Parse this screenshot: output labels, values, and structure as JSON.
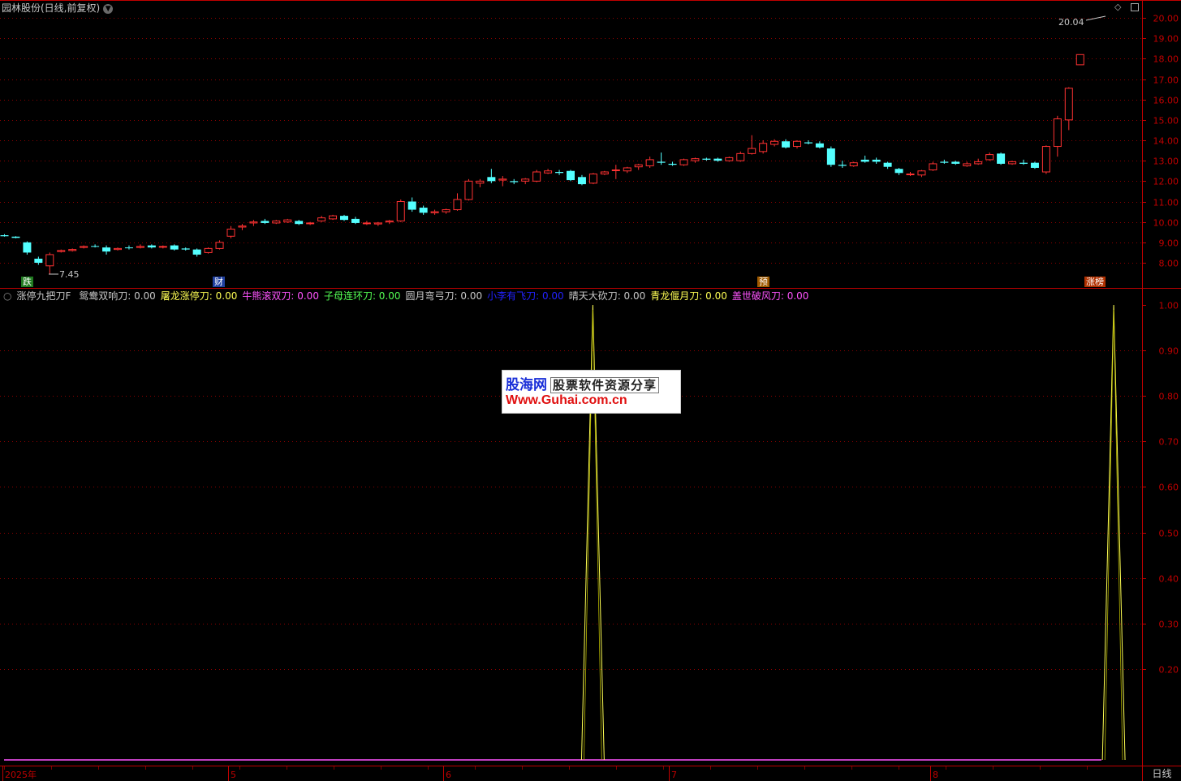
{
  "header": {
    "stock_title": "园林股份(日线,前复权)",
    "dropdown_icon": "chevron-down-icon",
    "max_price_label": "20.04",
    "min_price_label": "7.45"
  },
  "price_axis": {
    "ticks": [
      "20.00",
      "19.00",
      "18.00",
      "17.00",
      "16.00",
      "15.00",
      "14.00",
      "13.00",
      "12.00",
      "11.00",
      "10.00",
      "9.00",
      "8.00"
    ]
  },
  "indicator": {
    "name": "涨停九把刀F",
    "items": [
      {
        "label": "鸳鸯双响刀: 0.00",
        "color": "#c8c8c8"
      },
      {
        "label": "屠龙涨停刀: 0.00",
        "color": "#ffff54"
      },
      {
        "label": "牛熊滚双刀: 0.00",
        "color": "#ff54ff"
      },
      {
        "label": "子母连环刀: 0.00",
        "color": "#54ff54"
      },
      {
        "label": "圆月弯弓刀: 0.00",
        "color": "#c8c8c8"
      },
      {
        "label": "小李有飞刀: 0.00",
        "color": "#2222ff"
      },
      {
        "label": "晴天大砍刀: 0.00",
        "color": "#c8c8c8"
      },
      {
        "label": "青龙偃月刀: 0.00",
        "color": "#ffff54"
      },
      {
        "label": "盖世破风刀: 0.00",
        "color": "#ff54ff"
      }
    ],
    "axis_ticks": [
      "1.00",
      "0.90",
      "0.80",
      "0.70",
      "0.60",
      "0.50",
      "0.40",
      "0.30",
      "0.20"
    ]
  },
  "event_tags": [
    {
      "text": "跌",
      "bg": "#1f7a1f",
      "color": "#ffffff"
    },
    {
      "text": "财",
      "bg": "#1f3f9f",
      "color": "#ffffff"
    },
    {
      "text": "预",
      "bg": "#a05a00",
      "color": "#ffffff"
    },
    {
      "text": "涨榜",
      "bg": "#b03000",
      "color": "#ffffff"
    }
  ],
  "x_axis": {
    "labels": [
      "2025年",
      "5",
      "6",
      "7",
      "8"
    ]
  },
  "period_tab": "日线",
  "watermark": {
    "brand": "股海网",
    "slogan": "股票软件资源分享",
    "url": "Www.Guhai.com.cn"
  },
  "colors": {
    "up": "#ff3232",
    "down": "#54ffff",
    "grid": "#8b0000",
    "signal_line": "#ffff54",
    "baseline": "#ff54ff"
  },
  "chart_data": [
    {
      "type": "candlestick",
      "title": "园林股份(日线,前复权)",
      "ylim": [
        7.3,
        20.6
      ],
      "candles": [
        [
          9.35,
          9.4,
          9.28,
          9.3
        ],
        [
          9.28,
          9.3,
          9.2,
          9.22
        ],
        [
          9.0,
          9.05,
          8.4,
          8.5
        ],
        [
          8.2,
          8.3,
          7.9,
          8.0
        ],
        [
          7.85,
          8.5,
          7.45,
          8.4
        ],
        [
          8.55,
          8.65,
          8.5,
          8.6
        ],
        [
          8.6,
          8.7,
          8.55,
          8.65
        ],
        [
          8.75,
          8.85,
          8.7,
          8.8
        ],
        [
          8.82,
          8.9,
          8.75,
          8.8
        ],
        [
          8.75,
          8.85,
          8.4,
          8.55
        ],
        [
          8.65,
          8.75,
          8.6,
          8.7
        ],
        [
          8.75,
          8.85,
          8.65,
          8.72
        ],
        [
          8.75,
          8.9,
          8.7,
          8.8
        ],
        [
          8.85,
          8.9,
          8.7,
          8.75
        ],
        [
          8.78,
          8.85,
          8.7,
          8.8
        ],
        [
          8.85,
          8.9,
          8.6,
          8.65
        ],
        [
          8.7,
          8.75,
          8.6,
          8.65
        ],
        [
          8.65,
          8.7,
          8.3,
          8.4
        ],
        [
          8.5,
          8.75,
          8.45,
          8.7
        ],
        [
          8.7,
          9.1,
          8.65,
          9.0
        ],
        [
          9.3,
          9.8,
          9.2,
          9.65
        ],
        [
          9.75,
          9.9,
          9.6,
          9.8
        ],
        [
          9.95,
          10.1,
          9.8,
          10.0
        ],
        [
          10.05,
          10.15,
          9.9,
          9.95
        ],
        [
          9.95,
          10.1,
          9.9,
          10.05
        ],
        [
          10.0,
          10.15,
          9.95,
          10.1
        ],
        [
          10.05,
          10.1,
          9.85,
          9.9
        ],
        [
          9.95,
          10.0,
          9.85,
          9.95
        ],
        [
          10.05,
          10.3,
          10.0,
          10.2
        ],
        [
          10.15,
          10.35,
          10.1,
          10.3
        ],
        [
          10.3,
          10.35,
          10.05,
          10.1
        ],
        [
          10.15,
          10.25,
          9.9,
          9.95
        ],
        [
          9.95,
          10.05,
          9.85,
          9.95
        ],
        [
          9.9,
          10.0,
          9.8,
          9.95
        ],
        [
          10.0,
          10.1,
          9.9,
          10.05
        ],
        [
          10.05,
          11.1,
          10.0,
          11.0
        ],
        [
          11.0,
          11.2,
          10.5,
          10.6
        ],
        [
          10.7,
          10.8,
          10.35,
          10.45
        ],
        [
          10.45,
          10.6,
          10.35,
          10.5
        ],
        [
          10.5,
          10.65,
          10.4,
          10.6
        ],
        [
          10.6,
          11.4,
          10.55,
          11.1
        ],
        [
          11.1,
          12.1,
          11.05,
          12.0
        ],
        [
          11.9,
          12.1,
          11.7,
          12.0
        ],
        [
          12.2,
          12.6,
          11.9,
          12.0
        ],
        [
          12.05,
          12.25,
          11.75,
          12.1
        ],
        [
          12.0,
          12.1,
          11.85,
          11.95
        ],
        [
          12.0,
          12.15,
          11.85,
          12.1
        ],
        [
          12.0,
          12.55,
          11.95,
          12.45
        ],
        [
          12.4,
          12.6,
          12.35,
          12.5
        ],
        [
          12.45,
          12.55,
          12.3,
          12.4
        ],
        [
          12.5,
          12.55,
          12.0,
          12.05
        ],
        [
          12.2,
          12.3,
          11.8,
          11.85
        ],
        [
          11.9,
          12.4,
          11.85,
          12.35
        ],
        [
          12.35,
          12.5,
          12.3,
          12.45
        ],
        [
          12.55,
          12.8,
          12.1,
          12.55
        ],
        [
          12.5,
          12.7,
          12.4,
          12.65
        ],
        [
          12.7,
          12.85,
          12.55,
          12.8
        ],
        [
          12.75,
          13.2,
          12.65,
          13.05
        ],
        [
          12.95,
          13.4,
          12.8,
          12.9
        ],
        [
          12.85,
          12.95,
          12.75,
          12.8
        ],
        [
          12.8,
          13.1,
          12.75,
          13.05
        ],
        [
          13.0,
          13.15,
          12.9,
          13.1
        ],
        [
          13.1,
          13.15,
          13.0,
          13.05
        ],
        [
          13.1,
          13.15,
          12.95,
          13.0
        ],
        [
          13.0,
          13.2,
          12.95,
          13.15
        ],
        [
          13.0,
          13.45,
          12.95,
          13.35
        ],
        [
          13.35,
          14.25,
          13.3,
          13.6
        ],
        [
          13.45,
          14.0,
          13.35,
          13.85
        ],
        [
          13.8,
          14.05,
          13.7,
          13.95
        ],
        [
          13.95,
          14.05,
          13.6,
          13.65
        ],
        [
          13.7,
          14.0,
          13.6,
          13.95
        ],
        [
          13.9,
          14.0,
          13.8,
          13.85
        ],
        [
          13.85,
          13.95,
          13.6,
          13.65
        ],
        [
          13.6,
          13.7,
          12.7,
          12.8
        ],
        [
          12.8,
          13.0,
          12.65,
          12.75
        ],
        [
          12.75,
          12.95,
          12.7,
          12.9
        ],
        [
          13.05,
          13.25,
          12.9,
          12.95
        ],
        [
          13.05,
          13.15,
          12.85,
          12.95
        ],
        [
          12.9,
          12.95,
          12.6,
          12.7
        ],
        [
          12.6,
          12.65,
          12.3,
          12.4
        ],
        [
          12.35,
          12.45,
          12.25,
          12.35
        ],
        [
          12.3,
          12.55,
          12.2,
          12.5
        ],
        [
          12.55,
          12.95,
          12.5,
          12.85
        ],
        [
          12.95,
          13.05,
          12.85,
          12.9
        ],
        [
          12.95,
          13.0,
          12.8,
          12.85
        ],
        [
          12.75,
          12.95,
          12.7,
          12.85
        ],
        [
          12.85,
          13.1,
          12.8,
          12.95
        ],
        [
          13.05,
          13.4,
          13.0,
          13.3
        ],
        [
          13.35,
          13.4,
          12.8,
          12.85
        ],
        [
          12.85,
          13.0,
          12.8,
          12.95
        ],
        [
          12.9,
          13.05,
          12.8,
          12.85
        ],
        [
          12.9,
          12.95,
          12.6,
          12.65
        ],
        [
          12.45,
          13.75,
          12.35,
          13.7
        ],
        [
          13.7,
          15.2,
          13.2,
          15.05
        ],
        [
          15.0,
          16.6,
          14.5,
          16.55
        ],
        [
          17.7,
          18.2,
          17.7,
          18.2
        ]
      ]
    },
    {
      "type": "line",
      "title": "涨停九把刀F",
      "ylim": [
        0,
        1
      ],
      "series": [
        {
          "name": "屠龙涨停刀",
          "points": [
            [
              0,
              0
            ],
            [
              51,
              0
            ],
            [
              52,
              1
            ],
            [
              53,
              0
            ],
            [
              97,
              0
            ],
            [
              98,
              1
            ],
            [
              99,
              0
            ],
            [
              100,
              0
            ]
          ]
        }
      ]
    }
  ]
}
